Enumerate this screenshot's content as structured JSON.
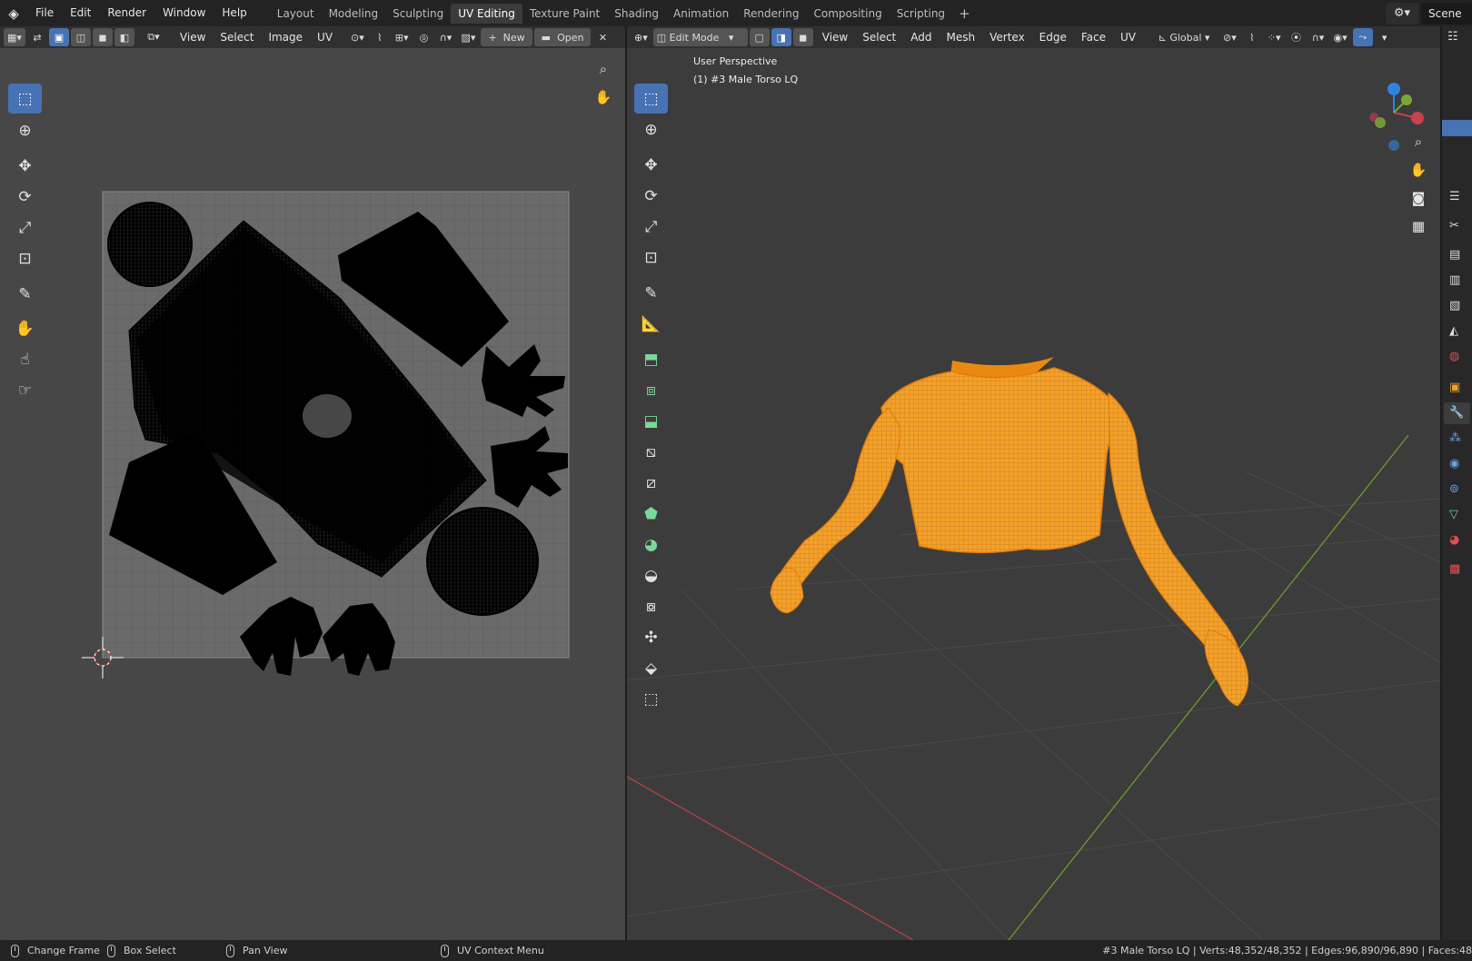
{
  "app": {
    "logo_icon": "blender-logo-icon",
    "menu": [
      "File",
      "Edit",
      "Render",
      "Window",
      "Help"
    ],
    "workspace_tabs": [
      {
        "label": "Layout",
        "active": false
      },
      {
        "label": "Modeling",
        "active": false
      },
      {
        "label": "Sculpting",
        "active": false
      },
      {
        "label": "UV Editing",
        "active": true
      },
      {
        "label": "Texture Paint",
        "active": false
      },
      {
        "label": "Shading",
        "active": false
      },
      {
        "label": "Animation",
        "active": false
      },
      {
        "label": "Rendering",
        "active": false
      },
      {
        "label": "Compositing",
        "active": false
      },
      {
        "label": "Scripting",
        "active": false
      }
    ],
    "add_tab": "+",
    "scene": "Scene"
  },
  "uv_editor": {
    "menus": [
      "View",
      "Select",
      "Image",
      "UV"
    ],
    "new_label": "New",
    "open_label": "Open"
  },
  "viewport": {
    "mode": "Edit Mode",
    "menus": [
      "View",
      "Select",
      "Add",
      "Mesh",
      "Vertex",
      "Edge",
      "Face",
      "UV"
    ],
    "orientation": "Global",
    "perspective": "User Perspective",
    "object_label": "(1) #3 Male Torso LQ",
    "gizmo_axes": [
      "Z",
      "Y",
      "X"
    ]
  },
  "status": {
    "items": [
      "Change Frame",
      "Box Select",
      "Pan View",
      "UV Context Menu"
    ],
    "stats": "#3 Male Torso LQ | Verts:48,352/48,352 | Edges:96,890/96,890 | Faces:48"
  },
  "colors": {
    "accent": "#4772b3",
    "mesh_orange": "#ffa21f",
    "x_axis": "#c8414e",
    "y_axis": "#7aa834",
    "z_axis": "#2f83e0"
  }
}
